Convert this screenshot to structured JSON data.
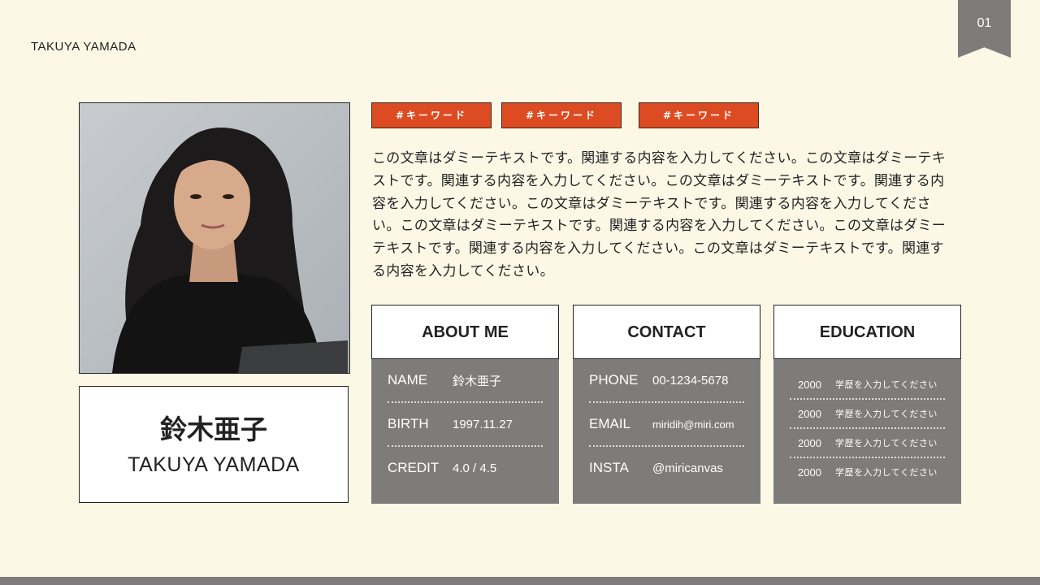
{
  "header": {
    "name": "TAKUYA YAMADA",
    "page_number": "01"
  },
  "profile": {
    "name_jp": "鈴木亜子",
    "name_en": "TAKUYA YAMADA"
  },
  "tags": [
    "#キーワード",
    "#キーワード",
    "#キーワード"
  ],
  "body_text": "この文章はダミーテキストです。関連する内容を入力してください。この文章はダミーテキストです。関連する内容を入力してください。この文章はダミーテキストです。関連する内容を入力してください。この文章はダミーテキストです。関連する内容を入力してください。この文章はダミーテキストです。関連する内容を入力してください。この文章はダミーテキストです。関連する内容を入力してください。この文章はダミーテキストです。関連する内容を入力してください。",
  "about": {
    "title": "ABOUT ME",
    "rows": [
      {
        "label": "NAME",
        "value": "鈴木亜子"
      },
      {
        "label": "BIRTH",
        "value": "1997.11.27"
      },
      {
        "label": "CREDIT",
        "value": "4.0 / 4.5"
      }
    ]
  },
  "contact": {
    "title": "CONTACT",
    "rows": [
      {
        "label": "PHONE",
        "value": "00-1234-5678"
      },
      {
        "label": "EMAIL",
        "value": "miridih@miri.com"
      },
      {
        "label": "INSTA",
        "value": "@miricanvas"
      }
    ]
  },
  "education": {
    "title": "EDUCATION",
    "rows": [
      {
        "year": "2000",
        "detail": "学歴を入力してください"
      },
      {
        "year": "2000",
        "detail": "学歴を入力してください"
      },
      {
        "year": "2000",
        "detail": "学歴を入力してください"
      },
      {
        "year": "2000",
        "detail": "学歴を入力してください"
      }
    ]
  },
  "colors": {
    "background": "#fdf8e6",
    "accent": "#dd4b22",
    "panel": "#7d7c7a"
  }
}
